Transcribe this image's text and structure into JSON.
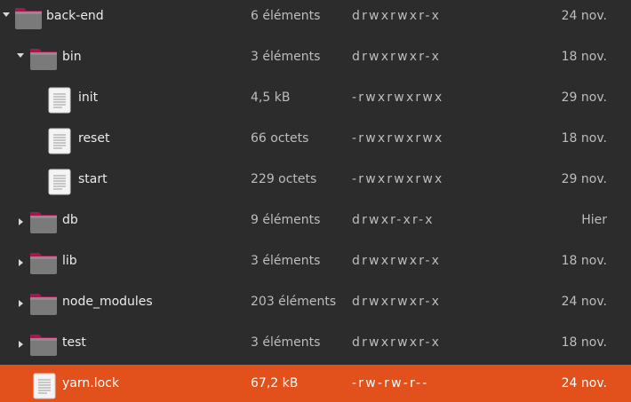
{
  "files": [
    {
      "name": "back-end",
      "size": "6 éléments",
      "perm": "drwxrwxr-x",
      "date": "24 nov.",
      "type": "folder",
      "expander": "open",
      "icon": "folder-icon"
    },
    {
      "name": "bin",
      "size": "3 éléments",
      "perm": "drwxrwxr-x",
      "date": "18 nov.",
      "type": "folder",
      "expander": "open",
      "icon": "folder-icon"
    },
    {
      "name": "init",
      "size": "4,5 kB",
      "perm": "-rwxrwxrwx",
      "date": "29 nov.",
      "type": "file",
      "expander": "none",
      "icon": "text-file-icon"
    },
    {
      "name": "reset",
      "size": "66 octets",
      "perm": "-rwxrwxrwx",
      "date": "18 nov.",
      "type": "file",
      "expander": "none",
      "icon": "text-file-icon"
    },
    {
      "name": "start",
      "size": "229 octets",
      "perm": "-rwxrwxrwx",
      "date": "29 nov.",
      "type": "file",
      "expander": "none",
      "icon": "text-file-icon"
    },
    {
      "name": "db",
      "size": "9 éléments",
      "perm": "drwxr-xr-x",
      "date": "Hier",
      "type": "folder",
      "expander": "closed",
      "icon": "folder-icon"
    },
    {
      "name": "lib",
      "size": "3 éléments",
      "perm": "drwxrwxr-x",
      "date": "18 nov.",
      "type": "folder",
      "expander": "closed",
      "icon": "folder-icon"
    },
    {
      "name": "node_modules",
      "size": "203 éléments",
      "perm": "drwxrwxr-x",
      "date": "24 nov.",
      "type": "folder",
      "expander": "closed",
      "icon": "folder-icon"
    },
    {
      "name": "test",
      "size": "3 éléments",
      "perm": "drwxrwxr-x",
      "date": "18 nov.",
      "type": "folder",
      "expander": "closed",
      "icon": "folder-icon"
    },
    {
      "name": "yarn.lock",
      "size": "67,2 kB",
      "perm": "-rw-rw-r--",
      "date": "24 nov.",
      "type": "file",
      "expander": "none",
      "icon": "text-file-icon",
      "selected": true
    }
  ],
  "colors": {
    "background": "#2c2c2c",
    "selection": "#e2501c",
    "folder_body": "#7a7a7a",
    "folder_tab": "#a5174f"
  }
}
